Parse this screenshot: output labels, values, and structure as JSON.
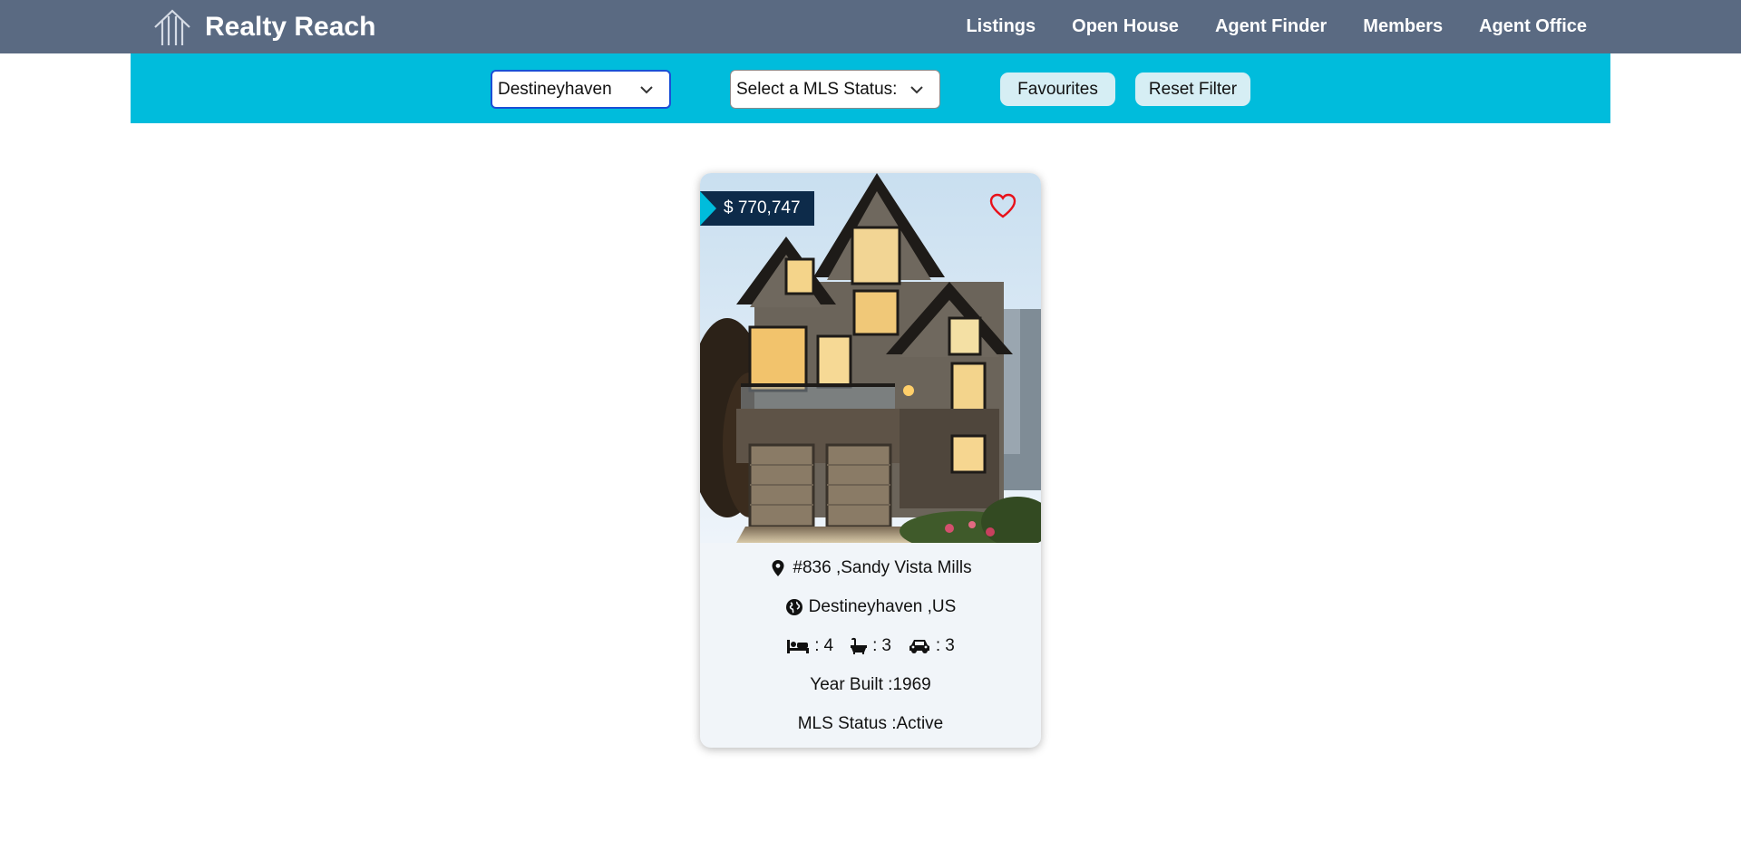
{
  "brand": {
    "name": "Realty Reach"
  },
  "nav": {
    "items": [
      "Listings",
      "Open House",
      "Agent Finder",
      "Members",
      "Agent Office"
    ]
  },
  "filters": {
    "city_value": "Destineyhaven",
    "mls_placeholder": "Select a MLS Status:",
    "favourites_label": "Favourites",
    "reset_label": "Reset Filter"
  },
  "listing": {
    "price": "$ 770,747",
    "address": "#836 ,Sandy Vista Mills",
    "location": "Destineyhaven ,US",
    "beds": "4",
    "baths": "3",
    "garage": "3",
    "year_built": "Year Built :1969",
    "mls_status": "MLS Status :Active"
  },
  "icons": {
    "logo": "house-logo-icon",
    "dropdown": "chevron-down-icon",
    "favourite": "heart-icon",
    "address": "map-pin-icon",
    "location": "globe-icon",
    "beds": "bed-icon",
    "baths": "bath-icon",
    "garage": "car-icon"
  },
  "colors": {
    "navbar": "#5a6a82",
    "filterbar": "#00bcdc",
    "price_tag": "#0d2b4a",
    "heart": "#e8111a",
    "card": "#f1f5f9"
  }
}
